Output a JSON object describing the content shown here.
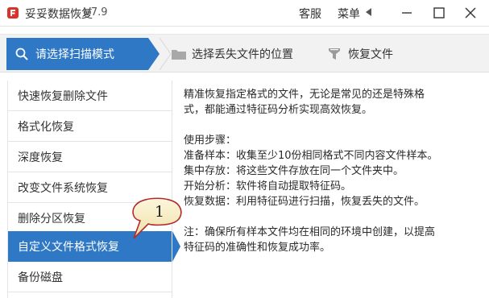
{
  "titlebar": {
    "app_name": "妥妥数据恢复",
    "version": "V7.9",
    "service_label": "客服",
    "menu_label": "菜单",
    "logo_icon": "app-logo-icon",
    "min_icon": "minimize-icon",
    "max_icon": "maximize-icon",
    "close_icon": "close-icon"
  },
  "steps": [
    {
      "label": "请选择扫描模式",
      "icon": "search-icon",
      "active": true
    },
    {
      "label": "选择丢失文件的位置",
      "icon": "folder-icon",
      "active": false
    },
    {
      "label": "恢复文件",
      "icon": "funnel-icon",
      "active": false
    }
  ],
  "nav": {
    "items": [
      {
        "label": "快速恢复删除文件"
      },
      {
        "label": "格式化恢复"
      },
      {
        "label": "深度恢复"
      },
      {
        "label": "改变文件系统恢复"
      },
      {
        "label": "删除分区恢复"
      },
      {
        "label": "自定义文件格式恢复",
        "selected": true
      },
      {
        "label": "备份磁盘"
      }
    ]
  },
  "description": {
    "intro_line1": "精准恢复指定格式的文件，无论是常见的还是特殊格",
    "intro_line2": "式，都能通过特征码分析实现高效恢复。",
    "steps_heading": "使用步骤：",
    "step1": "准备样本：收集至少10份相同格式不同内容文件样本。",
    "step2": "集中存放：将这些文件存放在同一个文件夹中。",
    "step3": "开始分析：软件将自动提取特征码。",
    "step4": "恢复数据：利用特征码进行扫描，恢复丢失的文件。",
    "note_line1": "注：确保所有样本文件均在相同的环境中创建，以提高",
    "note_line2": "特征码的准确性和恢复成功率。"
  },
  "annotation": {
    "number": "1"
  },
  "colors": {
    "accent": "#2f78c5",
    "logo_red": "#d9342b",
    "step_inactive_bg": "#f2f2f2"
  }
}
